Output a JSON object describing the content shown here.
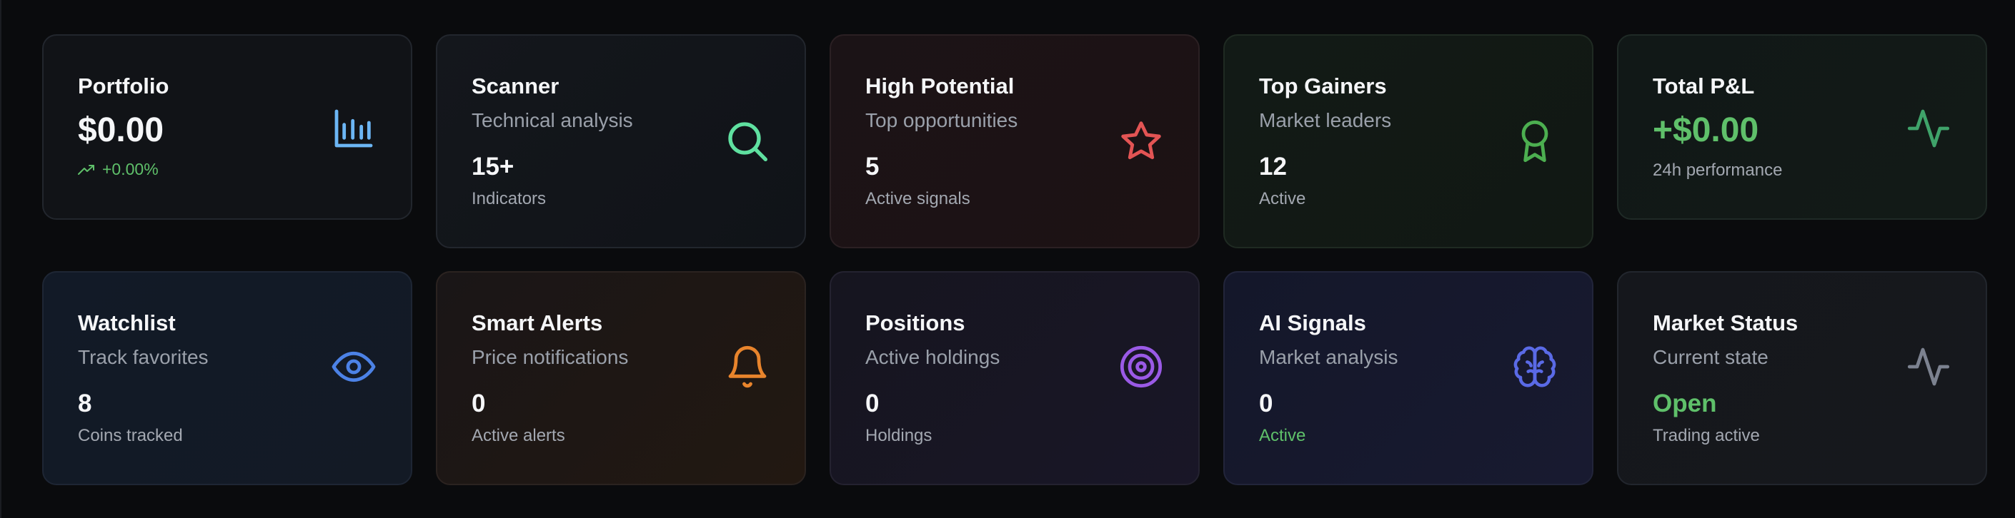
{
  "colors": {
    "background": "#0a0b0d",
    "positive": "#5fc06a",
    "portfolio_icon": "#6cb6f5",
    "scanner_icon": "#5fe0a0",
    "potential_icon": "#e35454",
    "gainers_icon": "#4caf50",
    "pnl_icon": "#3fa36a",
    "watch_icon": "#4c82e6",
    "alerts_icon": "#e8842c",
    "positions_icon": "#9a5ae6",
    "ai_icon": "#5a6ae6",
    "status_icon": "#7c8290"
  },
  "cards": {
    "portfolio": {
      "title": "Portfolio",
      "value": "$0.00",
      "change": "+0.00%",
      "icon": "bar-chart-icon"
    },
    "scanner": {
      "title": "Scanner",
      "subtitle": "Technical analysis",
      "value": "15+",
      "caption": "Indicators",
      "icon": "search-icon"
    },
    "high_potential": {
      "title": "High Potential",
      "subtitle": "Top opportunities",
      "value": "5",
      "caption": "Active signals",
      "icon": "star-icon"
    },
    "top_gainers": {
      "title": "Top Gainers",
      "subtitle": "Market leaders",
      "value": "12",
      "caption": "Active",
      "icon": "award-icon"
    },
    "total_pnl": {
      "title": "Total P&L",
      "value": "+$0.00",
      "caption": "24h performance",
      "icon": "activity-icon"
    },
    "watchlist": {
      "title": "Watchlist",
      "subtitle": "Track favorites",
      "value": "8",
      "caption": "Coins tracked",
      "icon": "eye-icon"
    },
    "smart_alerts": {
      "title": "Smart Alerts",
      "subtitle": "Price notifications",
      "value": "0",
      "caption": "Active alerts",
      "icon": "bell-icon"
    },
    "positions": {
      "title": "Positions",
      "subtitle": "Active holdings",
      "value": "0",
      "caption": "Holdings",
      "icon": "target-icon"
    },
    "ai_signals": {
      "title": "AI Signals",
      "subtitle": "Market analysis",
      "value": "0",
      "caption": "Active",
      "icon": "brain-icon"
    },
    "market_status": {
      "title": "Market Status",
      "subtitle": "Current state",
      "value": "Open",
      "caption": "Trading active",
      "icon": "activity-icon"
    }
  }
}
